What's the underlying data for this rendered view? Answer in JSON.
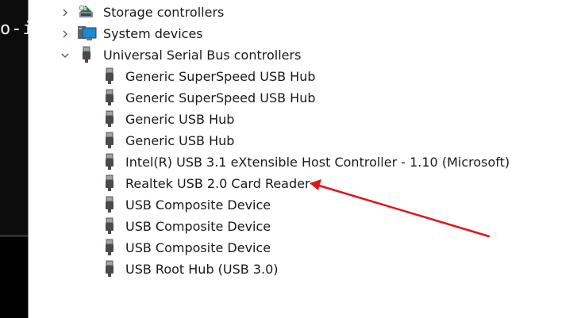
{
  "terminal": {
    "partial_text": "o-i"
  },
  "tree": {
    "categories": [
      {
        "label": "Storage controllers",
        "icon": "storage-controller-icon",
        "expanded": false
      },
      {
        "label": "System devices",
        "icon": "monitor-icon",
        "expanded": false
      },
      {
        "label": "Universal Serial Bus controllers",
        "icon": "usb-plug-icon",
        "expanded": true
      }
    ],
    "usb_children": [
      {
        "label": "Generic SuperSpeed USB Hub"
      },
      {
        "label": "Generic SuperSpeed USB Hub"
      },
      {
        "label": "Generic USB Hub"
      },
      {
        "label": "Generic USB Hub"
      },
      {
        "label": "Intel(R) USB 3.1 eXtensible Host Controller - 1.10 (Microsoft)"
      },
      {
        "label": "Realtek USB 2.0 Card Reader"
      },
      {
        "label": "USB Composite Device"
      },
      {
        "label": "USB Composite Device"
      },
      {
        "label": "USB Composite Device"
      },
      {
        "label": "USB Root Hub (USB 3.0)"
      }
    ]
  },
  "annotation": {
    "arrow_color": "#e0161b",
    "points_to": "Realtek USB 2.0 Card Reader"
  },
  "colors": {
    "text": "#1a1a1a",
    "chevron": "#5a5a5a",
    "terminal_bg": "#0c0c0c"
  }
}
